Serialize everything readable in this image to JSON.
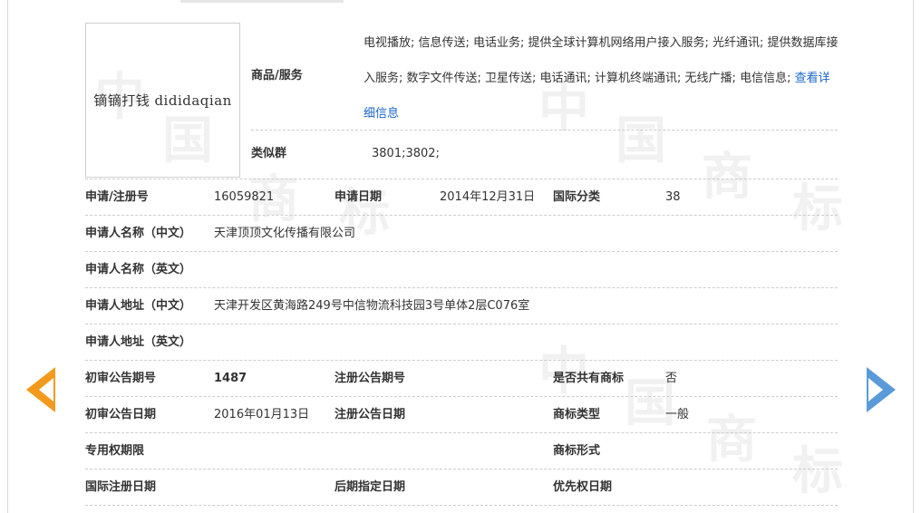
{
  "watermark": {
    "chars": [
      "中",
      "国",
      "商",
      "标",
      "中",
      "国",
      "商",
      "标",
      "中",
      "国",
      "商",
      "标"
    ]
  },
  "logo": {
    "text": "镝镝打钱 dididaqian"
  },
  "goods": {
    "label": "商品/服务",
    "text": "电视播放; 信息传送; 电话业务; 提供全球计算机网络用户接入服务; 光纤通讯; 提供数据库接入服务; 数字文件传送; 卫星传送; 电话通讯; 计算机终端通讯; 无线广播; 电信信息; ",
    "link": "查看详细信息"
  },
  "similar_group": {
    "label": "类似群",
    "value": "3801;3802;"
  },
  "reg": {
    "no_label": "申请/注册号",
    "no_value": "16059821",
    "date_label": "申请日期",
    "date_value": "2014年12月31日",
    "class_label": "国际分类",
    "class_value": "38"
  },
  "applicant_cn": {
    "label": "申请人名称（中文）",
    "value": "天津顶顶文化传播有限公司"
  },
  "applicant_en": {
    "label": "申请人名称（英文）",
    "value": ""
  },
  "address_cn": {
    "label": "申请人地址（中文）",
    "value": "天津开发区黄海路249号中信物流科技园3号单体2层C076室"
  },
  "address_en": {
    "label": "申请人地址（英文）",
    "value": ""
  },
  "prelim": {
    "issue_label": "初审公告期号",
    "issue_value": "1487",
    "reg_issue_label": "注册公告期号",
    "reg_issue_value": "",
    "shared_label": "是否共有商标",
    "shared_value": "否"
  },
  "prelim_date": {
    "label": "初审公告日期",
    "value": "2016年01月13日",
    "reg_date_label": "注册公告日期",
    "reg_date_value": "",
    "type_label": "商标类型",
    "type_value": "一般"
  },
  "exclusive": {
    "label": "专用权期限",
    "value": "",
    "form_label": "商标形式",
    "form_value": ""
  },
  "intl": {
    "label": "国际注册日期",
    "value": "",
    "later_label": "后期指定日期",
    "later_value": "",
    "priority_label": "优先权日期",
    "priority_value": ""
  }
}
